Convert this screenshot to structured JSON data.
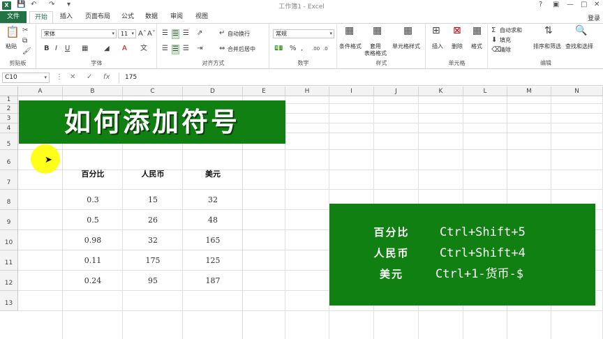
{
  "titlebar": {
    "app_title": "工作簿1 - Excel",
    "app_icon": "X"
  },
  "tabs": {
    "file": "文件",
    "home": "开始",
    "insert": "插入",
    "page_layout": "页面布局",
    "formulas": "公式",
    "data": "数据",
    "review": "审阅",
    "view": "视图",
    "login": "登录"
  },
  "ribbon": {
    "clipboard": {
      "label": "剪贴板",
      "paste": "粘贴"
    },
    "font": {
      "label": "字体",
      "name": "宋体",
      "size": "11"
    },
    "alignment": {
      "label": "对齐方式",
      "wrap": "自动换行",
      "merge": "合并后居中"
    },
    "number": {
      "label": "数字",
      "format": "常规"
    },
    "styles": {
      "label": "样式",
      "conditional": "条件格式",
      "table": "套用\n表格格式",
      "cell_styles": "单元格样式"
    },
    "cells": {
      "label": "单元格",
      "insert": "插入",
      "delete": "删除",
      "format": "格式"
    },
    "editing": {
      "label": "编辑",
      "autosum": "自动求和",
      "fill": "填充",
      "clear": "清除",
      "sort": "排序和筛选",
      "find": "查找和选择"
    }
  },
  "formula_bar": {
    "name_box": "C10",
    "value": "175"
  },
  "grid": {
    "columns": [
      "A",
      "B",
      "C",
      "D",
      "E",
      "H",
      "I",
      "J",
      "K",
      "L",
      "M",
      "N"
    ],
    "rows": [
      "1",
      "2",
      "3",
      "4",
      "5",
      "6",
      "7",
      "8",
      "9",
      "10",
      "11",
      "12",
      "13"
    ]
  },
  "banner": {
    "title": "如何添加符号"
  },
  "table": {
    "headers": [
      "百分比",
      "人民币",
      "美元"
    ],
    "rows": [
      [
        "0.3",
        "15",
        "32"
      ],
      [
        "0.5",
        "26",
        "48"
      ],
      [
        "0.98",
        "32",
        "165"
      ],
      [
        "0.11",
        "175",
        "125"
      ],
      [
        "0.24",
        "95",
        "187"
      ]
    ]
  },
  "shortcuts": [
    {
      "name": "百分比",
      "keys": "Ctrl+Shift+5"
    },
    {
      "name": "人民币",
      "keys": "Ctrl+Shift+4"
    },
    {
      "name": "美元",
      "keys": "Ctrl+1-货币-$"
    }
  ],
  "colors": {
    "excel_green": "#217346",
    "banner_green": "#118012",
    "highlight": "#ffff00"
  }
}
